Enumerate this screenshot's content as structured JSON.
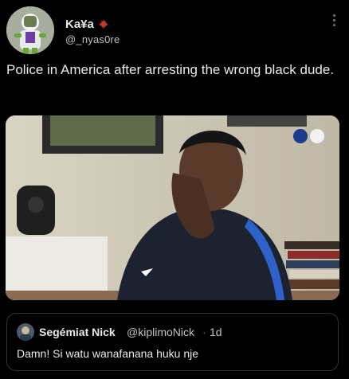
{
  "tweet": {
    "author_name": "Ka¥a",
    "author_handle": "@_nyas0re",
    "text": "Police in America after arresting the wrong black dude."
  },
  "media": {
    "description_icon": "video-still",
    "badges": [
      "FFF",
      "EDF"
    ]
  },
  "quote": {
    "author_name": "Segémiat Nick",
    "author_handle": "@kiplimoNick",
    "separator": "·",
    "time": "1d",
    "text": "Damn! Si watu wanafanana huku nje"
  },
  "colors": {
    "background": "#000000",
    "text": "#e7e9ea",
    "secondary": "#71767b",
    "border": "#2f3336",
    "verified_accent": "#c0392b"
  }
}
